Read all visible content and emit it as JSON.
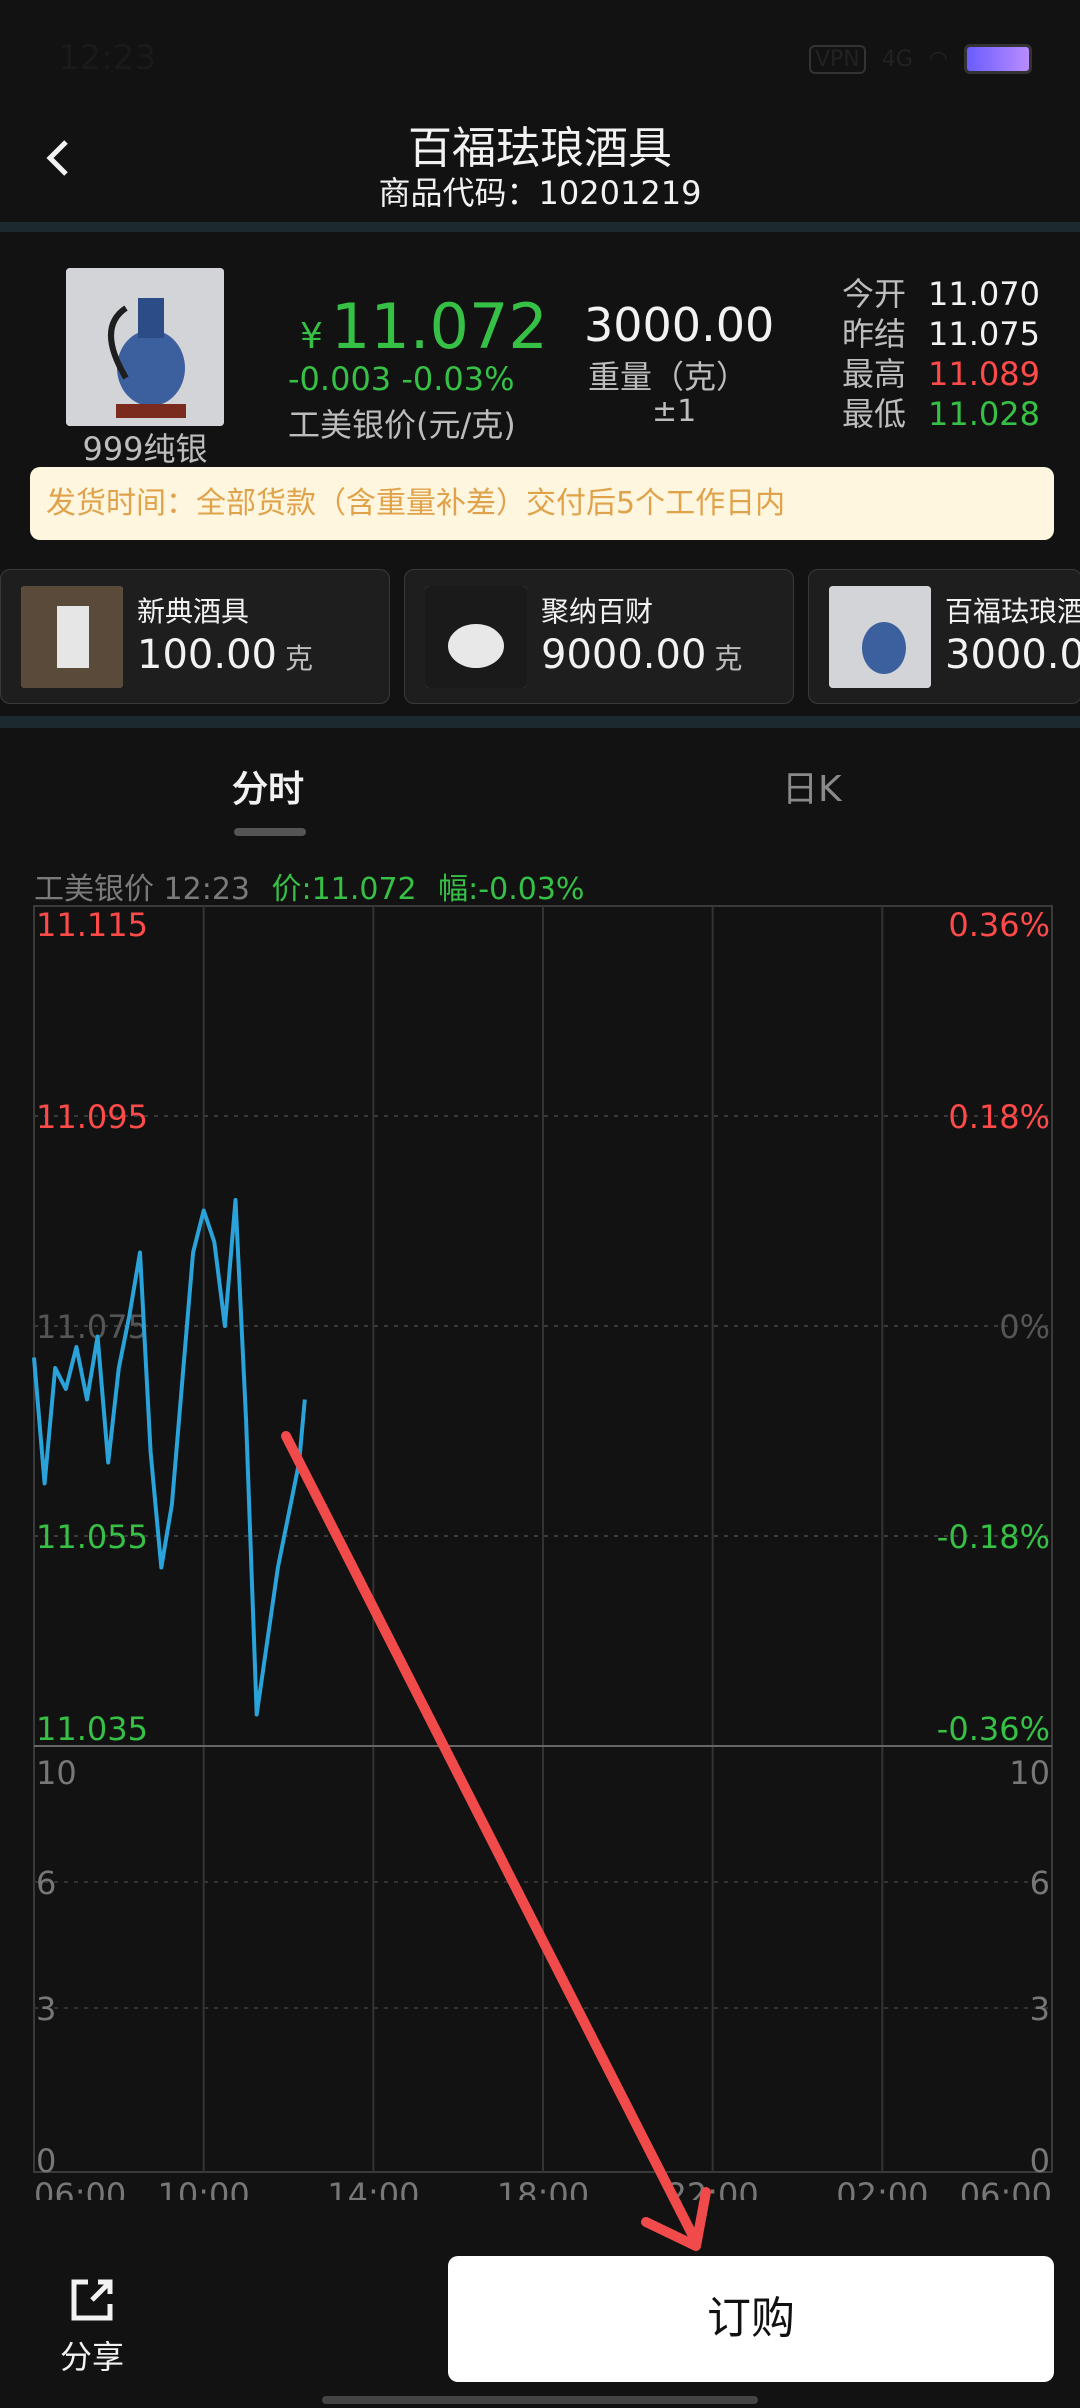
{
  "status_bar": {
    "time": "12:23",
    "vpn": "VPN",
    "signal": "4G"
  },
  "header": {
    "title": "百福珐琅酒具",
    "product_code": "商品代码：10201219"
  },
  "summary": {
    "thumb_caption": "999纯银",
    "currency_symbol": "¥",
    "price": "11.072",
    "change": "-0.003  -0.03%",
    "price_label": "工美银价(元/克)",
    "weight": "3000.00",
    "weight_label": "重量（克）",
    "weight_tolerance": "±1",
    "stats": [
      {
        "label": "今开",
        "value": "11.070",
        "color": "#f2f2f2"
      },
      {
        "label": "昨结",
        "value": "11.075",
        "color": "#f2f2f2"
      },
      {
        "label": "最高",
        "value": "11.089",
        "color": "#ff4a4a"
      },
      {
        "label": "最低",
        "value": "11.028",
        "color": "#36c046"
      }
    ]
  },
  "delivery_notice": "发货时间：全部货款（含重量补差）交付后5个工作日内",
  "products": [
    {
      "name": "新典酒具",
      "amount": "100.00",
      "unit": "克"
    },
    {
      "name": "聚纳百财",
      "amount": "9000.00",
      "unit": "克"
    },
    {
      "name": "百福珐琅酒",
      "amount": "3000.0",
      "unit": ""
    }
  ],
  "tabs": [
    {
      "label": "分时",
      "active": true
    },
    {
      "label": "日K",
      "active": false
    }
  ],
  "chart_header": {
    "name_time": "工美银价 12:23",
    "price": "价:11.072",
    "range": "幅:-0.03%"
  },
  "chart_data": {
    "type": "line",
    "x_ticks": [
      "06:00",
      "10:00",
      "14:00",
      "18:00",
      "22:00",
      "02:00",
      "06:00"
    ],
    "y_ticks_left": [
      "11.115",
      "11.095",
      "11.075",
      "11.055",
      "11.035"
    ],
    "y_ticks_right": [
      "0.36%",
      "0.18%",
      "0%",
      "-0.18%",
      "-0.36%"
    ],
    "volume_ticks_left": [
      "10",
      "6",
      "3",
      "0"
    ],
    "volume_ticks_right": [
      "10",
      "6",
      "3",
      "0"
    ],
    "ylim": [
      11.035,
      11.115
    ],
    "line_color": "#29a3d9",
    "series": [
      {
        "x": [
          "06:00",
          "06:15",
          "06:30",
          "06:45",
          "07:00",
          "07:15",
          "07:30",
          "07:45",
          "08:00",
          "08:15",
          "08:30",
          "08:45",
          "09:00",
          "09:15",
          "09:30",
          "09:45",
          "10:00",
          "10:15",
          "10:30",
          "10:45",
          "11:00",
          "11:15",
          "11:30",
          "11:45",
          "12:00",
          "12:15",
          "12:23"
        ],
        "values": [
          11.072,
          11.06,
          11.071,
          11.069,
          11.073,
          11.068,
          11.074,
          11.062,
          11.071,
          11.076,
          11.082,
          11.063,
          11.052,
          11.058,
          11.07,
          11.082,
          11.086,
          11.083,
          11.075,
          11.087,
          11.066,
          11.038,
          11.045,
          11.052,
          11.057,
          11.062,
          11.068
        ]
      }
    ]
  },
  "bottom": {
    "share_label": "分享",
    "buy_label": "订购"
  },
  "colors": {
    "accent_green": "#36c046",
    "accent_red": "#ff4a4a",
    "annotation_arrow": "#f04a4a"
  }
}
